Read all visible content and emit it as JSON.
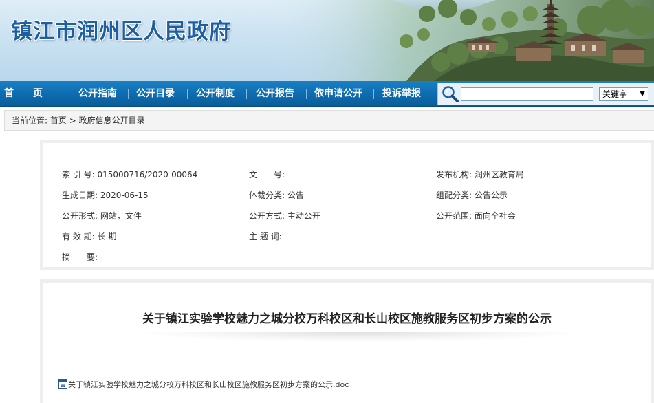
{
  "banner": {
    "site_title": "镇江市润州区人民政府"
  },
  "nav": {
    "items": [
      "首　　页",
      "公开指南",
      "公开目录",
      "公开制度",
      "公开报告",
      "依申请公开",
      "投诉举报"
    ],
    "search": {
      "placeholder": "",
      "select_value": "关键字"
    }
  },
  "breadcrumb": {
    "label": "当前位置:",
    "home": "首页",
    "separator": ">",
    "current": "政府信息公开目录"
  },
  "info": {
    "index_no": {
      "label": "索 引 号:",
      "value": "015000716/2020-00064"
    },
    "doc_no": {
      "label": "文　　号:",
      "value": ""
    },
    "publisher": {
      "label": "发布机构:",
      "value": "润州区教育局"
    },
    "created": {
      "label": "生成日期:",
      "value": "2020-06-15"
    },
    "genre": {
      "label": "体裁分类:",
      "value": "公告"
    },
    "category": {
      "label": "组配分类:",
      "value": "公告公示"
    },
    "form": {
      "label": "公开形式:",
      "value": "网站，文件"
    },
    "method": {
      "label": "公开方式:",
      "value": "主动公开"
    },
    "scope": {
      "label": "公开范围:",
      "value": "面向全社会"
    },
    "validity": {
      "label": "有 效 期:",
      "value": "长 期"
    },
    "keywords": {
      "label": "主 题 词:",
      "value": ""
    },
    "abstract": {
      "label": "摘　　要:",
      "value": ""
    }
  },
  "content": {
    "title": "关于镇江实验学校魅力之城分校万科校区和长山校区施教服务区初步方案的公示",
    "attachment": "关于镇江实验学校魅力之城分校万科校区和长山校区施教服务区初步方案的公示.doc"
  },
  "colors": {
    "nav_blue": "#0e6db0",
    "title_blue": "#1c5fa3"
  },
  "icons": [
    "search-icon",
    "word-doc-icon",
    "chevron-down-icon",
    "pagoda-scenery"
  ]
}
